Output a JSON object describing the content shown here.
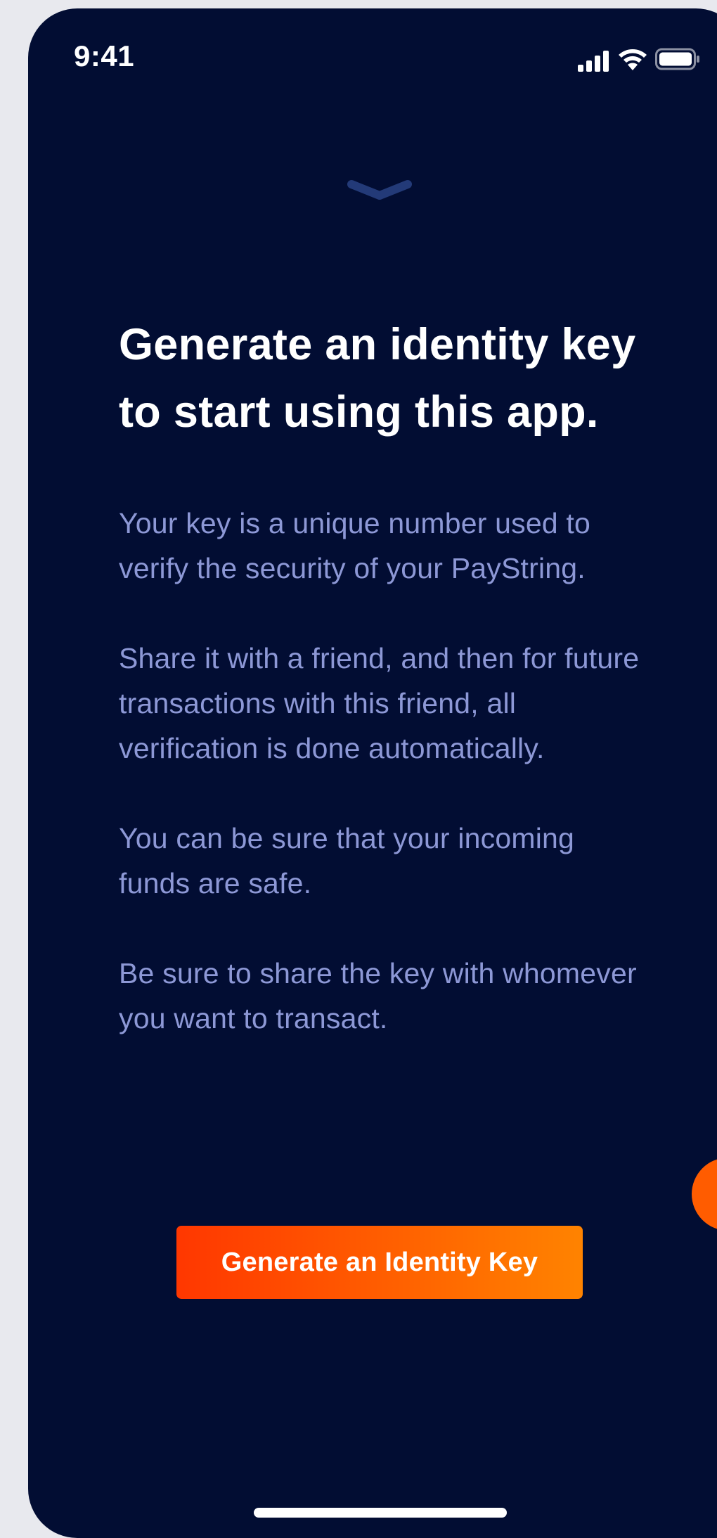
{
  "status_bar": {
    "time": "9:41",
    "icons": [
      "signal-icon",
      "wifi-icon",
      "battery-icon"
    ]
  },
  "sheet": {
    "handle_icon": "chevron-down-icon"
  },
  "onboarding": {
    "title": "Generate an identity key to start using this app.",
    "paragraphs": [
      "Your key is a unique number used to verify the security of your PayString.",
      "Share it with a friend, and then for future transactions with this friend, all verification is done automatically.",
      "You can be sure that your incoming funds are safe.",
      "Be sure to share the key with whomever you want to transact."
    ],
    "button_label": "Generate an Identity Key"
  },
  "colors": {
    "background": "#020d33",
    "title_text": "#ffffff",
    "body_text": "#8d98d6",
    "accent_start": "#ff3700",
    "accent_end": "#ff8300",
    "handle": "#233a78"
  }
}
